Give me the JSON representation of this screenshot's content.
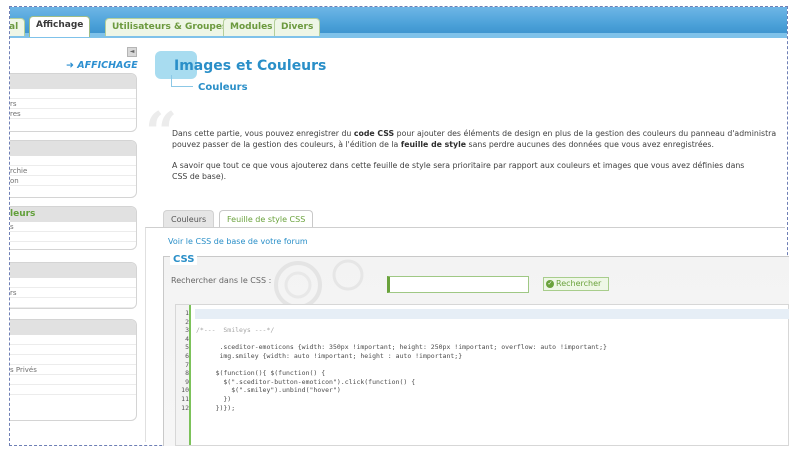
{
  "tabs": [
    "al",
    "Affichage",
    "Utilisateurs & Groupes",
    "Modules",
    "Divers"
  ],
  "sidebar": {
    "collapse_icon": "◄",
    "section_title": "➜ AFFICHAGE",
    "boxes": [
      {
        "header": "",
        "items": [
          "",
          "rs",
          "res"
        ]
      },
      {
        "header": "",
        "items": [
          "",
          "rchie",
          "on"
        ]
      },
      {
        "header": "leurs",
        "items": [
          "s",
          "",
          ""
        ]
      },
      {
        "header": "",
        "items": [
          "",
          "rs",
          ""
        ]
      },
      {
        "header": "",
        "items": [
          "",
          "",
          "",
          "s Privés",
          "",
          ""
        ]
      }
    ]
  },
  "main": {
    "title": "Images et Couleurs",
    "subtitle": "Couleurs",
    "para1": [
      "Dans cette partie, vous pouvez enregistrer du ",
      "code CSS",
      " pour ajouter des éléments de design en plus de la gestion des couleurs du panneau d'administra",
      "pouvez passer de la gestion des couleurs, à l'édition de la ",
      "feuille de style",
      " sans perdre aucunes des données que vous avez enregistrées."
    ],
    "para2": [
      "A savoir que tout ce que vous ajouterez dans cette feuille de style sera prioritaire par rapport aux couleurs et images que vous avez définies dans",
      "CSS de base)."
    ]
  },
  "css_tabs": [
    "Couleurs",
    "Feuille de style CSS"
  ],
  "panel": {
    "link": "Voir le CSS de base de votre forum",
    "legend": "CSS",
    "search_label": "Rechercher dans le CSS :",
    "search_value": "",
    "search_button": "Rechercher"
  },
  "editor": {
    "line_numbers": [
      "1",
      "2",
      "3",
      "4",
      "5",
      "6",
      "7",
      "8",
      "9",
      "10",
      "11",
      "12"
    ],
    "lines": [
      "",
      "",
      "/*---  Smileys ---*/",
      "",
      "      .sceditor-emoticons {width: 350px !important; height: 250px !important; overflow: auto !important;}",
      "      img.smiley {width: auto !important; height : auto !important;}",
      "",
      "     $(function(){ $(function() {",
      "       $(\".sceditor-button-emoticon\").click(function() {",
      "         $(\".smiley\").unbind(\"hover\")",
      "       })",
      "     })});"
    ]
  },
  "colors": {
    "accent_blue": "#2a8fc8",
    "accent_green": "#6aa23c",
    "topbar_blue": "#4aa0d8"
  }
}
